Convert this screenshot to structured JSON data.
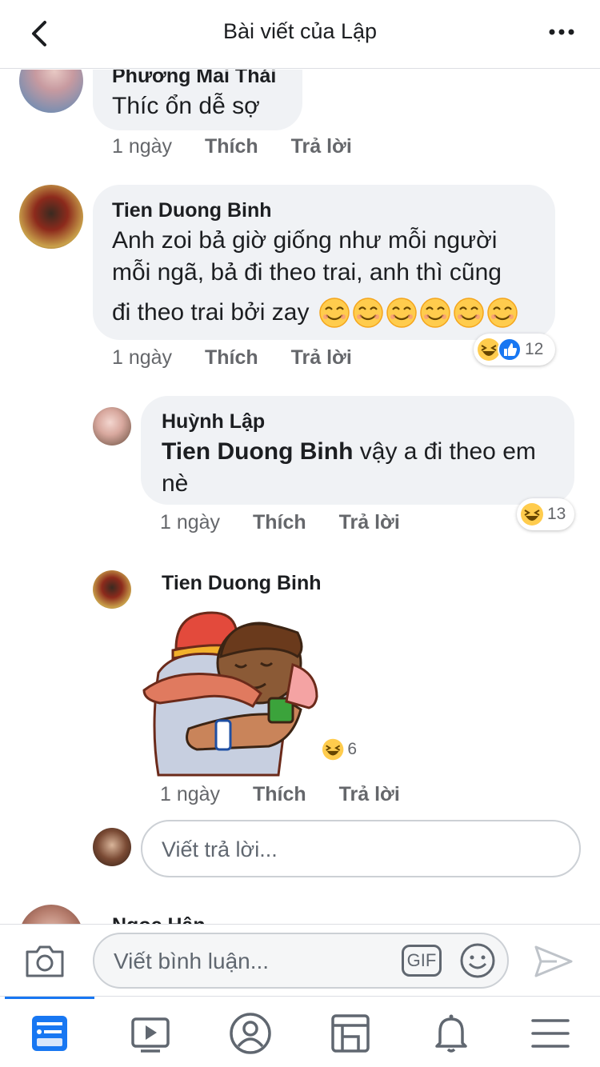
{
  "header": {
    "title": "Bài viết của Lập"
  },
  "comments": [
    {
      "author": "Phương Mai Thái",
      "text": "Thíc ổn dễ sợ",
      "time": "1 ngày",
      "like": "Thích",
      "reply": "Trả lời"
    },
    {
      "author": "Tien Duong Binh",
      "text_line1": "Anh zoi bả giờ giống như mỗi người",
      "text_line2": "mỗi ngã, bả đi theo trai, anh thì cũng",
      "text_line3": "đi theo trai bởi zay",
      "time": "1 ngày",
      "like": "Thích",
      "reply": "Trả lời",
      "reaction_count": "12"
    },
    {
      "author": "Huỳnh Lập",
      "mention": "Tien Duong Binh",
      "text": " vậy a đi theo em",
      "text_line2": "nè",
      "time": "1 ngày",
      "like": "Thích",
      "reply": "Trả lời",
      "reaction_count": "13"
    },
    {
      "author": "Tien Duong Binh",
      "time": "1 ngày",
      "like": "Thích",
      "reply": "Trả lời",
      "reaction_count": "6",
      "sticker": "hug-sticker"
    },
    {
      "author": "Ngọc Hân"
    }
  ],
  "reply_input": {
    "placeholder": "Viết trả lời..."
  },
  "composer": {
    "placeholder": "Viết bình luận...",
    "gif_label": "GIF"
  },
  "colors": {
    "accent": "#1877f2",
    "bubble": "#f0f2f5",
    "meta": "#65676b"
  },
  "tabs": [
    "news-feed-icon",
    "watch-icon",
    "profile-icon",
    "pages-icon",
    "notifications-icon",
    "menu-icon"
  ]
}
